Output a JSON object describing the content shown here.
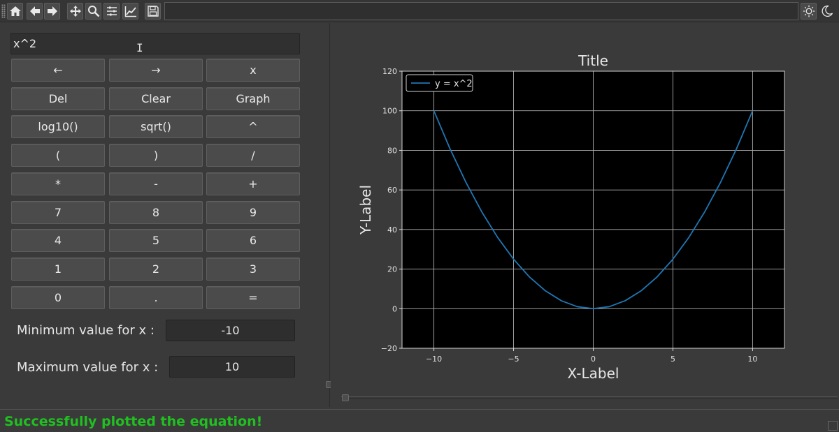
{
  "toolbar": {
    "buttons": [
      "home-icon",
      "back-arrow-icon",
      "forward-arrow-icon",
      "pan-icon",
      "zoom-icon",
      "subplots-icon",
      "edit-axes-icon",
      "save-icon"
    ],
    "theme_buttons": [
      "light-theme-icon",
      "dark-theme-icon"
    ]
  },
  "calculator": {
    "expression": "x^2",
    "keys": [
      "←",
      "→",
      "x",
      "Del",
      "Clear",
      "Graph",
      "log10()",
      "sqrt()",
      "^",
      "(",
      ")",
      "/",
      "*",
      "-",
      "+",
      "7",
      "8",
      "9",
      "4",
      "5",
      "6",
      "1",
      "2",
      "3",
      "0",
      ".",
      "="
    ],
    "min_label": "Minimum value for x :",
    "min_value": "-10",
    "max_label": "Maximum value for x :",
    "max_value": "10"
  },
  "chart_data": {
    "type": "line",
    "title": "Title",
    "xlabel": "X-Label",
    "ylabel": "Y-Label",
    "xlim": [
      -12,
      12
    ],
    "ylim": [
      -20,
      120
    ],
    "x_ticks": [
      -10,
      -5,
      0,
      5,
      10
    ],
    "y_ticks": [
      -20,
      0,
      20,
      40,
      60,
      80,
      100,
      120
    ],
    "x_tick_labels": [
      "−10",
      "−5",
      "0",
      "5",
      "10"
    ],
    "y_tick_labels": [
      "−20",
      "0",
      "20",
      "40",
      "60",
      "80",
      "100",
      "120"
    ],
    "grid": true,
    "legend_position": "top-left",
    "background": "#000000",
    "line_color": "#1f77b4",
    "series": [
      {
        "name": "y = x^2",
        "x": [
          -10,
          -9,
          -8,
          -7,
          -6,
          -5,
          -4,
          -3,
          -2,
          -1,
          0,
          1,
          2,
          3,
          4,
          5,
          6,
          7,
          8,
          9,
          10
        ],
        "y": [
          100,
          81,
          64,
          49,
          36,
          25,
          16,
          9,
          4,
          1,
          0,
          1,
          4,
          9,
          16,
          25,
          36,
          49,
          64,
          81,
          100
        ]
      }
    ]
  },
  "status": {
    "message": "Successfully plotted the equation!",
    "color": "#20c020"
  }
}
